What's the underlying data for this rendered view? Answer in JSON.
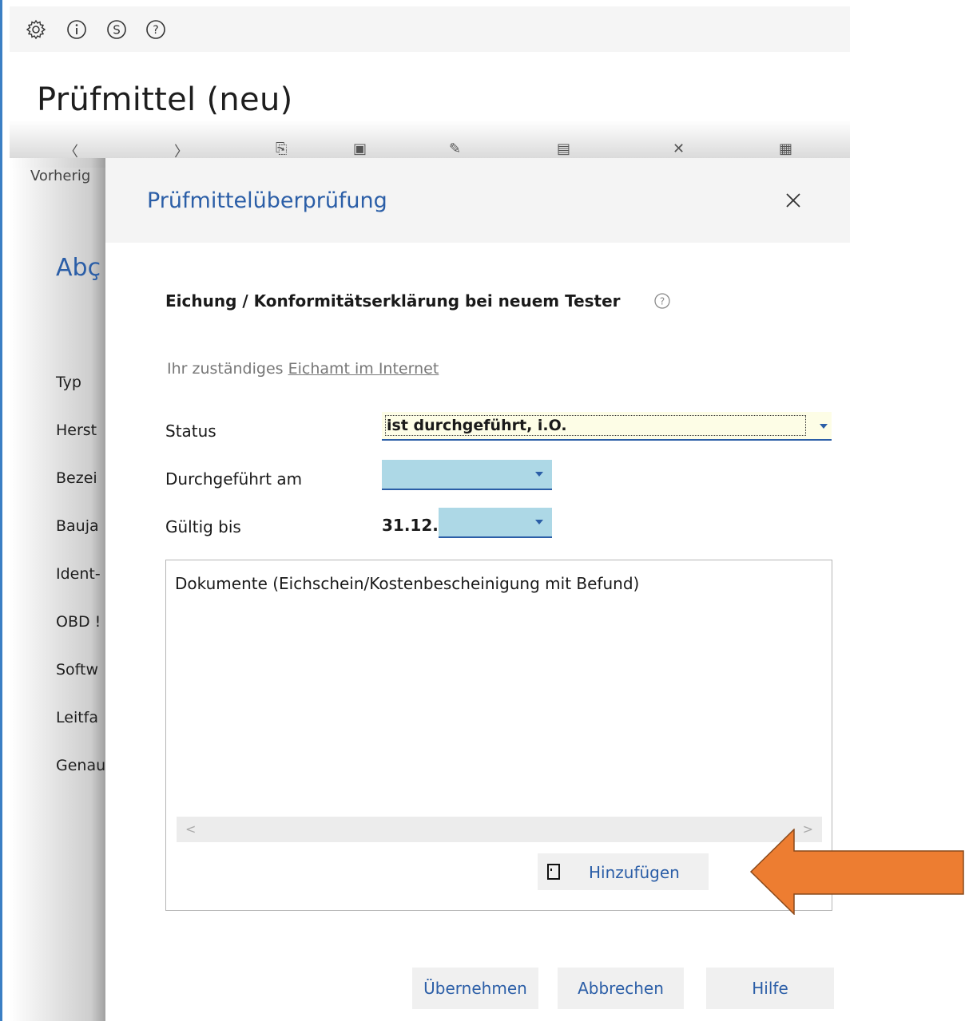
{
  "toolbar_icons": [
    "gear-icon",
    "info-icon",
    "dollar-icon",
    "help-icon"
  ],
  "background": {
    "page_title": "Prüfmittel (neu)",
    "prev_label_partial": "Vorherig",
    "section_partial": "Abç",
    "fields": [
      "Typ",
      "Herst",
      "Bezei",
      "Bauja",
      "Ident-",
      "OBD !",
      "Softw",
      "Leitfa",
      "Genau"
    ]
  },
  "dialog": {
    "title": "Prüfmittelüberprüfung",
    "section_title": "Eichung / Konformitätserklärung bei neuem Tester",
    "hint_prefix": "Ihr zuständiges",
    "hint_link": "Eichamt im Internet",
    "status_label": "Status",
    "status_value": "ist durchgeführt, i.O.",
    "performed_label": "Durchgeführt am",
    "performed_value": "",
    "valid_label": "Gültig bis",
    "valid_prefix": "31.12.",
    "valid_value": "",
    "documents_title": "Dokumente (Eichschein/Kostenbescheinigung mit Befund)",
    "scroll_left": "<",
    "scroll_right": ">",
    "add_label": "Hinzufügen",
    "buttons": {
      "apply": "Übernehmen",
      "cancel": "Abbrechen",
      "help": "Hilfe"
    }
  },
  "colors": {
    "accent": "#2b5ea7",
    "highlight_arrow": "#ed7d31",
    "date_field": "#add8e6",
    "status_field": "#fdfde6"
  }
}
